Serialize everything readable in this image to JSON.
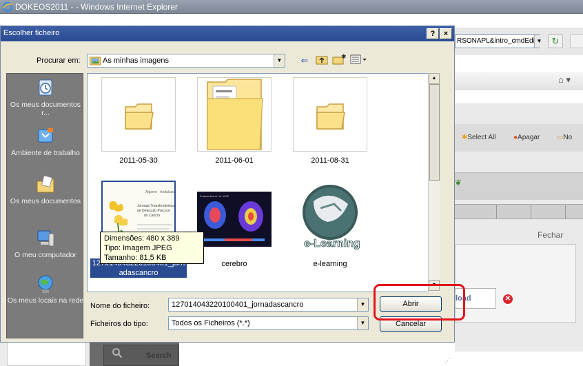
{
  "browser": {
    "window_title": "DOKEOS2011 - - Windows Internet Explorer",
    "address_text": "RSONAPL&intro_cmdEdit",
    "page": {
      "select_all": "Select All",
      "apagar": "Apagar",
      "novo": "No",
      "fechar": "Fechar",
      "upload_label": "load",
      "search_label": "Search"
    }
  },
  "dialog": {
    "title": "Escolher ficheiro",
    "help_label": "?",
    "close_label": "×",
    "look_in_label": "Procurar em:",
    "look_in_value": "As minhas imagens",
    "places": [
      {
        "label": "Os meus documentos r..."
      },
      {
        "label": "Ambiente de trabalho"
      },
      {
        "label": "Os meus documentos"
      },
      {
        "label": "O meu computador"
      },
      {
        "label": "Os meus locais na rede"
      }
    ],
    "files": [
      {
        "name": "2011-05-30",
        "kind": "folder"
      },
      {
        "name": "2011-06-01",
        "kind": "folder"
      },
      {
        "name": "2011-08-31",
        "kind": "folder"
      },
      {
        "name": "127014043220100401_jornadascancro",
        "kind": "image",
        "selected": true
      },
      {
        "name": "cerebro",
        "kind": "image"
      },
      {
        "name": "e-learning",
        "kind": "image"
      }
    ],
    "tooltip": {
      "dimensions": "Dimensões: 480 x 389",
      "type": "Tipo: Imagem JPEG",
      "size": "Tamanho: 81,5 KB"
    },
    "file_name_label": "Nome do ficheiro:",
    "file_name_value": "127014043220100401_jornadascancro",
    "file_type_label": "Ficheiros do tipo:",
    "file_type_value": "Todos os Ficheiros (*.*)",
    "open_label": "Abrir",
    "cancel_label": "Cancelar",
    "thumb_texts": {
      "poster_title": "Jornada Transfronteiriça de Detecção Precoce do Cancro",
      "elearning_text": "e-Learning"
    },
    "highlight_color": "#e1141b"
  }
}
